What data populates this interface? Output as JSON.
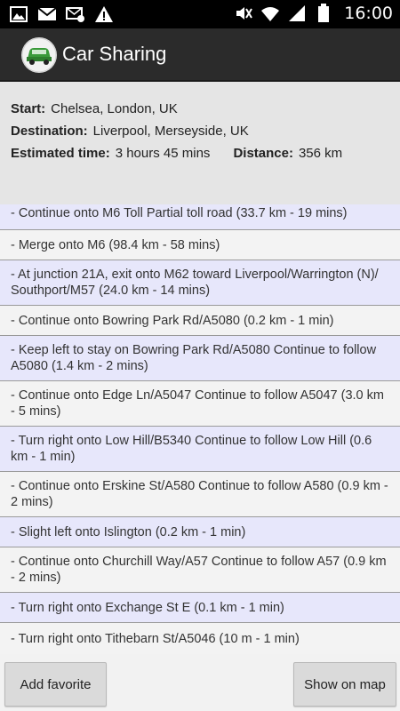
{
  "status_bar": {
    "time": "16:00",
    "icons_left": [
      "image-icon",
      "gmail-icon",
      "email-icon",
      "warning-icon"
    ],
    "icons_right": [
      "mute-icon",
      "wifi-icon",
      "signal-icon",
      "battery-icon"
    ]
  },
  "action_bar": {
    "title": "Car Sharing"
  },
  "summary": {
    "start_label": "Start:",
    "start_value": "Chelsea, London, UK",
    "destination_label": "Destination:",
    "destination_value": "Liverpool, Merseyside, UK",
    "time_label": "Estimated time:",
    "time_value": "3 hours 45 mins",
    "distance_label": "Distance:",
    "distance_value": "356 km"
  },
  "directions": [
    "- Continue onto M6 Toll Partial toll road (33.7 km - 19 mins)",
    "- Merge onto M6 (98.4 km - 58 mins)",
    "- At junction 21A, exit onto M62 toward Liverpool/Warrington (N)/ Southport/M57 (24.0 km - 14 mins)",
    "- Continue onto Bowring Park Rd/A5080 (0.2 km - 1 min)",
    "- Keep left to stay on Bowring Park Rd/A5080 Continue to follow A5080 (1.4 km - 2 mins)",
    "- Continue onto Edge Ln/A5047 Continue to follow A5047 (3.0 km - 5 mins)",
    "- Turn right onto Low Hill/B5340 Continue to follow Low Hill (0.6 km - 1 min)",
    "- Continue onto Erskine St/A580 Continue to follow A580 (0.9 km - 2 mins)",
    "- Slight left onto Islington (0.2 km - 1 min)",
    "- Continue onto Churchill Way/A57 Continue to follow A57 (0.9 km - 2 mins)",
    "- Turn right onto Exchange St E (0.1 km - 1 min)",
    "- Turn right onto Tithebarn St/A5046 (10 m - 1 min)"
  ],
  "buttons": {
    "add_favorite": "Add favorite",
    "show_on_map": "Show on map"
  },
  "colors": {
    "action_bar": "#2b2b2b",
    "row_odd": "#e7e7fb",
    "row_even": "#f3f3f3",
    "app_icon_green": "#3a9a3a"
  }
}
